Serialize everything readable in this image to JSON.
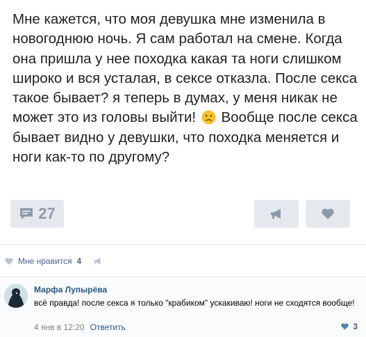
{
  "post": {
    "text_before_emoji": "Мне кажется, что моя девушка мне изменила в новогоднюю ночь. Я сам работал на смене. Когда она пришла у нее походка какая та ноги слишком широко и вся усталая, в сексе отказла. После секса такое бывает? я теперь в думах, у меня никак не может это из головы выйти!",
    "emoji": "sad-face-emoji",
    "text_after_emoji": "Вообще после секса бывает видно у девушки, что походка меняется и ноги как-то по другому?"
  },
  "actions": {
    "comments_count": "27",
    "comment_icon": "comment-bubble-icon",
    "share_icon": "megaphone-share-icon",
    "like_icon": "heart-icon"
  },
  "likes": {
    "label": "Мне нравится",
    "count": "4"
  },
  "comment": {
    "author": "Марфа Лупырёва",
    "text": "всё правда! после секса я только \"крабиком\" ускакиваю! ноги не сходятся вообще!",
    "date": "4 янв в 12:20",
    "reply_label": "Ответить",
    "likes_count": "3"
  },
  "colors": {
    "link": "#2a5885",
    "icon_gray": "#8d9aab",
    "button_bg": "#e5e9ee",
    "comment_like_blue": "#5181b8"
  }
}
